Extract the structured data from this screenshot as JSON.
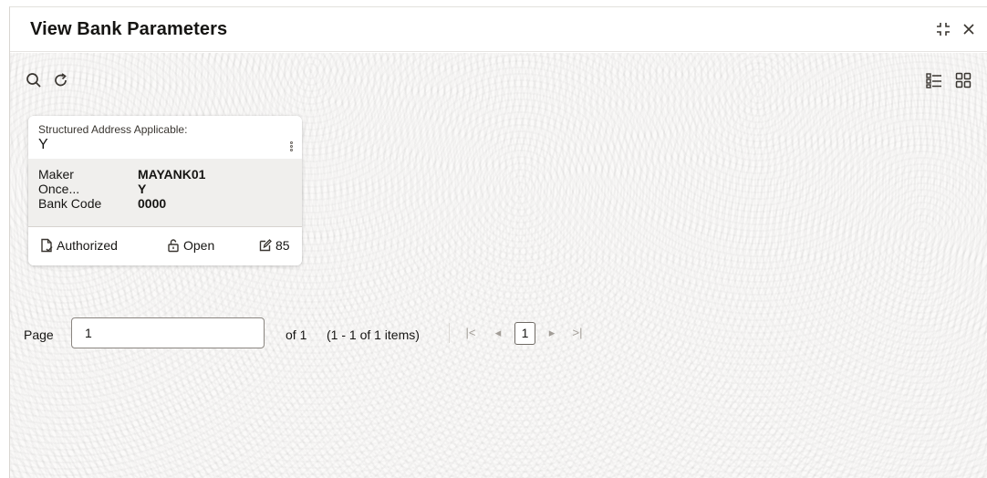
{
  "window": {
    "title": "View Bank Parameters",
    "icons": {
      "minimize": "collapse-icon",
      "close": "close-icon"
    }
  },
  "toolbar": {
    "icons": {
      "search": "search-icon",
      "refresh": "refresh-icon",
      "list_view": "list-view-icon",
      "grid_view": "grid-view-icon"
    }
  },
  "card": {
    "label": "Structured Address Applicable:",
    "value": "Y",
    "fields": [
      {
        "key": "Maker",
        "value": "MAYANK01"
      },
      {
        "key": "Once...",
        "value": "Y"
      },
      {
        "key": "Bank Code",
        "value": "0000"
      }
    ],
    "footer": {
      "status": "Authorized",
      "lock_state": "Open",
      "modification_count": "85"
    },
    "icons": {
      "status": "authorized-doc-icon",
      "lock": "unlock-icon",
      "edit": "edit-icon",
      "menu": "kebab-menu-icon"
    }
  },
  "pager": {
    "label": "Page",
    "current_page": "1",
    "of_text": "of 1",
    "range_text": "(1 - 1 of 1 items)",
    "page_button": "1",
    "nav": {
      "first": "|<",
      "prev": "◂",
      "next": "▸",
      "last": ">|"
    }
  },
  "colors": {
    "title_text": "#161513",
    "background_pattern": "#fbfaf9",
    "card_mid": "#f0efed",
    "icon_gray": "#3a3631",
    "nav_disabled": "#a29d97"
  }
}
